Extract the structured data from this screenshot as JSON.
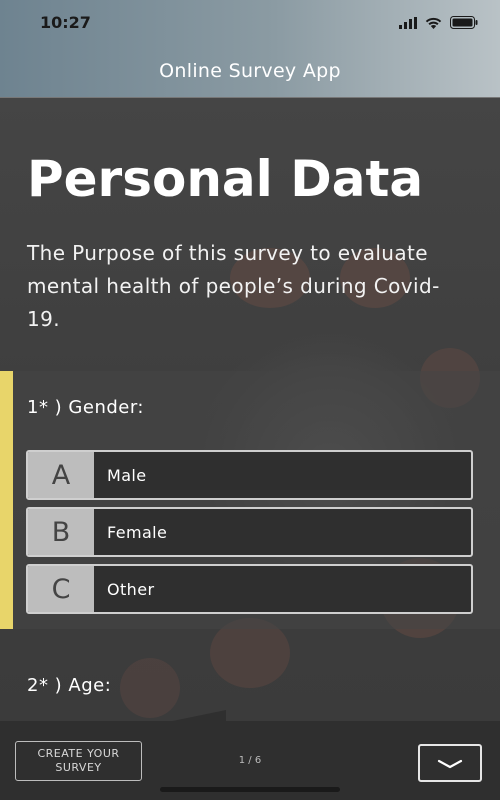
{
  "status_bar": {
    "time": "10:27",
    "icons": [
      "signal-icon",
      "wifi-icon",
      "battery-icon"
    ]
  },
  "header": {
    "title": "Online Survey App"
  },
  "section": {
    "title": "Personal Data",
    "intro": "The Purpose of this survey to evaluate mental health of people’s during Covid-19."
  },
  "questions": [
    {
      "label": "1* )  Gender:",
      "options": [
        {
          "letter": "A",
          "text": "Male"
        },
        {
          "letter": "B",
          "text": "Female"
        },
        {
          "letter": "C",
          "text": "Other"
        }
      ]
    },
    {
      "label": "2* )  Age:"
    }
  ],
  "footer": {
    "create_label": "CREATE YOUR SURVEY",
    "page_indicator": "1 / 6",
    "next_icon": "chevron-down-icon"
  },
  "colors": {
    "accent": "#e8d56a",
    "header_start": "#6e8390",
    "header_end": "#b9c2c6",
    "background": "#3d3d3d"
  }
}
